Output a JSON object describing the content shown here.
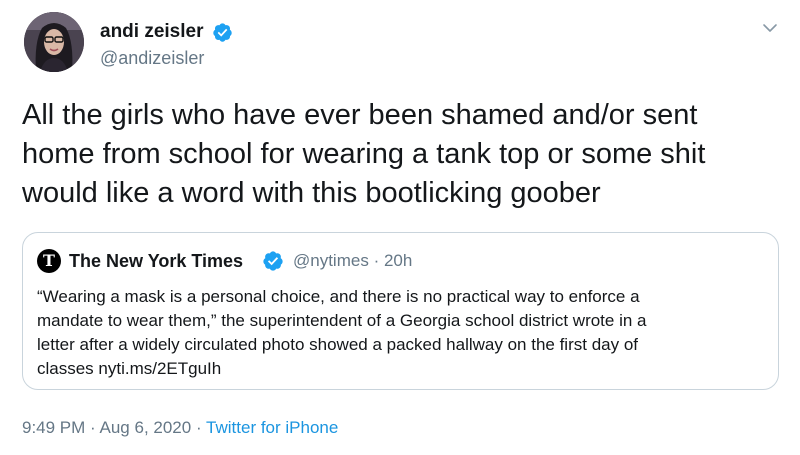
{
  "author": {
    "name": "andi zeisler",
    "handle": "@andizeisler",
    "verified": true
  },
  "tweet": {
    "text_lines": [
      "All the girls who have ever been shamed and/or sent",
      "home from school for wearing a tank top or some shit",
      "would like a word with this bootlicking goober"
    ]
  },
  "quoted_tweet": {
    "logo_glyph": "T",
    "name": "The New York Times",
    "handle": "@nytimes",
    "separator": "·",
    "time": "20h",
    "text_lines": [
      "“Wearing a mask is a personal choice, and there is no practical way to enforce a",
      "mandate to wear them,” the superintendent of a Georgia school district wrote in a",
      "letter after a widely circulated photo showed a packed hallway on the first day of",
      "classes nyti.ms/2ETguIh"
    ]
  },
  "footer": {
    "time": "9:49 PM",
    "separator": "·",
    "date": "Aug 6, 2020",
    "source": "Twitter for iPhone"
  },
  "colors": {
    "text": "#14171a",
    "secondary": "#657786",
    "link": "#1b95e0",
    "verified_badge": "#1da1f2",
    "card_border": "#c9d4dc"
  },
  "icons": {
    "verified": "verified-badge-icon",
    "caret": "chevron-down-icon",
    "nyt_logo": "nyt-logo-icon"
  }
}
